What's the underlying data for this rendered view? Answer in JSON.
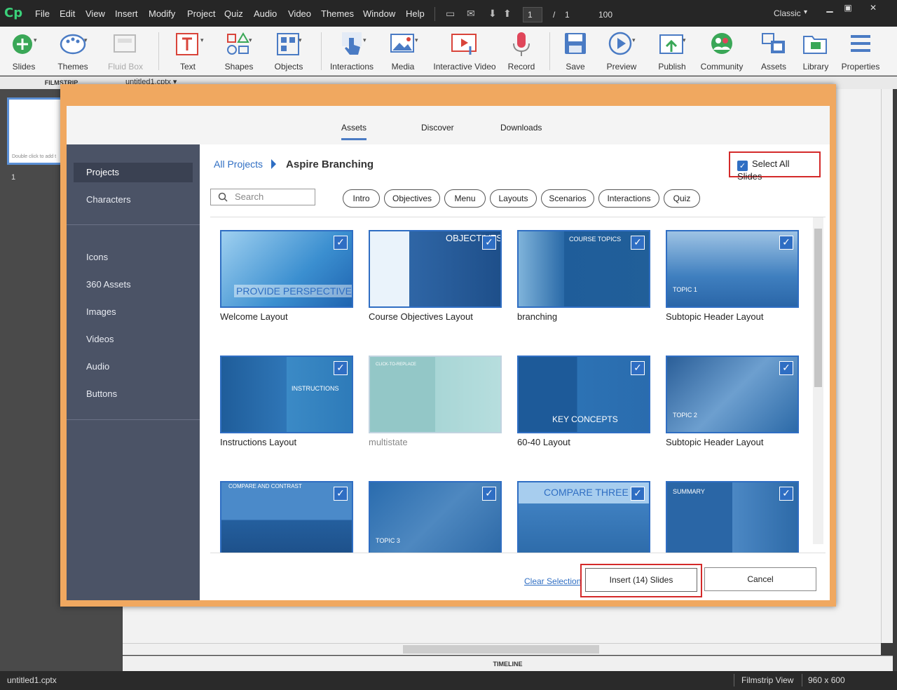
{
  "app": {
    "menus": [
      "File",
      "Edit",
      "View",
      "Insert",
      "Modify",
      "Project",
      "Quiz",
      "Audio",
      "Video",
      "Themes",
      "Window",
      "Help"
    ],
    "page_current": "1",
    "page_separator": "/",
    "page_total": "1",
    "zoom": "100",
    "workspace": "Classic",
    "workspace_caret": "▾"
  },
  "toolbar": {
    "slides": "Slides",
    "themes": "Themes",
    "fluid_box": "Fluid Box",
    "text": "Text",
    "shapes": "Shapes",
    "objects": "Objects",
    "interactions": "Interactions",
    "media": "Media",
    "interactive_video": "Interactive Video",
    "record": "Record",
    "save": "Save",
    "preview": "Preview",
    "publish": "Publish",
    "community": "Community",
    "assets": "Assets",
    "library": "Library",
    "properties": "Properties"
  },
  "filmstrip": {
    "header": "FILMSTRIP",
    "thumb_hint": "Double click to add t",
    "slide_number": "1"
  },
  "document": {
    "tab": "untitled1.cptx",
    "tab_caret": "▾"
  },
  "timeline": "TIMELINE",
  "status": {
    "file": "untitled1.cptx",
    "view": "Filmstrip View",
    "size": "960 x 600"
  },
  "dialog": {
    "tabs": [
      "Assets",
      "Discover",
      "Downloads"
    ],
    "sidebar_top": [
      "Projects",
      "Characters"
    ],
    "sidebar_bottom": [
      "Icons",
      "360 Assets",
      "Images",
      "Videos",
      "Audio",
      "Buttons"
    ],
    "breadcrumb_root": "All Projects",
    "breadcrumb_current": "Aspire Branching",
    "select_all": "Select All Slides",
    "search_placeholder": "Search",
    "filters": [
      "Intro",
      "Objectives",
      "Menu",
      "Layouts",
      "Scenarios",
      "Interactions",
      "Quiz"
    ],
    "thumbs": [
      {
        "name": "Welcome Layout",
        "overlay": "PROVIDE PERSPECTIVE"
      },
      {
        "name": "Course Objectives Layout",
        "overlay": "OBJECTIVES"
      },
      {
        "name": "branching",
        "overlay": "COURSE TOPICS"
      },
      {
        "name": "Subtopic Header Layout",
        "overlay": "TOPIC 1"
      },
      {
        "name": "Instructions Layout",
        "overlay": "INSTRUCTIONS"
      },
      {
        "name": "multistate",
        "overlay": "CLICK-TO-REPLACE"
      },
      {
        "name": "60-40 Layout",
        "overlay": "KEY CONCEPTS"
      },
      {
        "name": "Subtopic Header Layout",
        "overlay": "TOPIC 2"
      },
      {
        "name": "",
        "overlay": "COMPARE AND CONTRAST"
      },
      {
        "name": "",
        "overlay": "TOPIC 3"
      },
      {
        "name": "",
        "overlay": "COMPARE THREE"
      },
      {
        "name": "",
        "overlay": "SUMMARY"
      }
    ],
    "clear_selection": "Clear Selection",
    "insert": "Insert (14) Slides",
    "cancel": "Cancel"
  }
}
